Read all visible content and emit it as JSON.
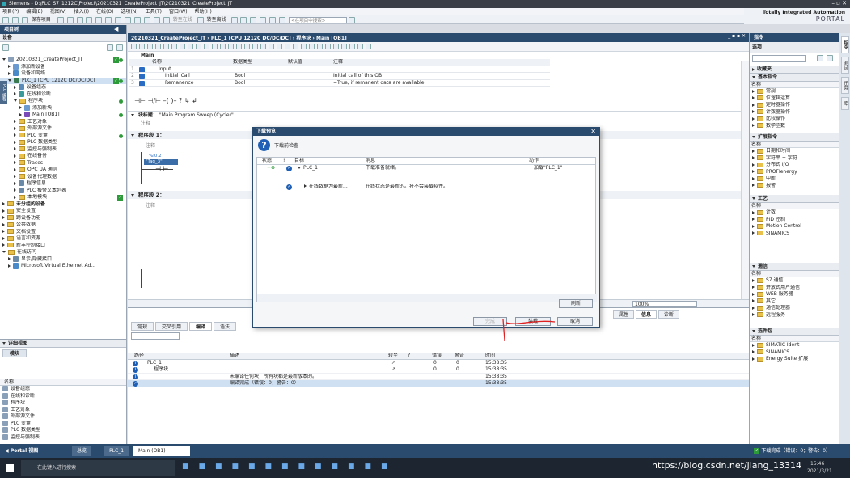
{
  "title": "Siemens - D:\\PLC_S7_1212C\\Project\\20210321_CreateProject_JT\\20210321_CreateProject_JT",
  "menu": [
    "项目(P)",
    "编辑(E)",
    "视图(V)",
    "插入(I)",
    "在线(O)",
    "选项(N)",
    "工具(T)",
    "窗口(W)",
    "帮助(H)"
  ],
  "toolbar": {
    "save_label": "保存项目",
    "go_online": "转至在线",
    "go_offline": "转至离线",
    "search_placeholder": "<在项目中搜索>"
  },
  "brand": {
    "line1": "Totally Integrated Automation",
    "line2": "PORTAL"
  },
  "project_tree": {
    "header": "项目树",
    "devices_tab": "设备",
    "items": [
      {
        "label": "20210321_CreateProject_JT",
        "indent": 0,
        "open": true,
        "status": "both",
        "icon": "project"
      },
      {
        "label": "添加新设备",
        "indent": 1,
        "icon": "add"
      },
      {
        "label": "设备和网络",
        "indent": 1,
        "icon": "net"
      },
      {
        "label": "PLC_1 [CPU 1212C DC/DC/DC]",
        "indent": 1,
        "open": true,
        "status": "both",
        "icon": "plc",
        "selected": true
      },
      {
        "label": "设备组态",
        "indent": 2,
        "icon": "cfg"
      },
      {
        "label": "在线和诊断",
        "indent": 2,
        "icon": "diag"
      },
      {
        "label": "程序块",
        "indent": 2,
        "open": true,
        "status": "dot",
        "icon": "folder"
      },
      {
        "label": "添加新块",
        "indent": 3,
        "icon": "add"
      },
      {
        "label": "Main [OB1]",
        "indent": 3,
        "status": "dot",
        "icon": "ob"
      },
      {
        "label": "工艺对象",
        "indent": 2,
        "icon": "folder"
      },
      {
        "label": "外部源文件",
        "indent": 2,
        "icon": "folder"
      },
      {
        "label": "PLC 变量",
        "indent": 2,
        "status": "dot",
        "icon": "folder"
      },
      {
        "label": "PLC 数据类型",
        "indent": 2,
        "icon": "folder"
      },
      {
        "label": "监控与强制表",
        "indent": 2,
        "icon": "folder"
      },
      {
        "label": "在线备份",
        "indent": 2,
        "icon": "folder"
      },
      {
        "label": "Traces",
        "indent": 2,
        "icon": "folder"
      },
      {
        "label": "OPC UA 通信",
        "indent": 2,
        "icon": "folder"
      },
      {
        "label": "设备代理数据",
        "indent": 2,
        "icon": "folder"
      },
      {
        "label": "程序信息",
        "indent": 2,
        "icon": "info"
      },
      {
        "label": "PLC 报警文本列表",
        "indent": 2,
        "icon": "info"
      },
      {
        "label": "本地模块",
        "indent": 2,
        "status": "chk",
        "icon": "folder"
      },
      {
        "label": "未分组的设备",
        "indent": 0,
        "icon": "folder",
        "bold": true
      },
      {
        "label": "安全设置",
        "indent": 0,
        "icon": "folder"
      },
      {
        "label": "跨设备功能",
        "indent": 0,
        "icon": "folder"
      },
      {
        "label": "公共数据",
        "indent": 0,
        "icon": "folder"
      },
      {
        "label": "文档设置",
        "indent": 0,
        "icon": "folder"
      },
      {
        "label": "语言和资源",
        "indent": 0,
        "icon": "folder"
      },
      {
        "label": "新丰控制接口",
        "indent": 0,
        "icon": "folder"
      },
      {
        "label": "在线访问",
        "indent": 0,
        "open": true,
        "icon": "folder"
      },
      {
        "label": "显示/隐藏接口",
        "indent": 1,
        "icon": "info"
      },
      {
        "label": "Microsoft Virtual Ethernet Ad...",
        "indent": 1,
        "icon": "net"
      }
    ]
  },
  "details": {
    "header": "详细视图",
    "tab": "模块",
    "col": "名称",
    "items": [
      "设备组态",
      "在线和诊断",
      "程序块",
      "工艺对象",
      "外部源文件",
      "PLC 变量",
      "PLC 数据类型",
      "监控与强制表"
    ]
  },
  "editor": {
    "title": "20210321_CreateProject_JT › PLC_1 [CPU 1212C DC/DC/DC] › 程序块 › Main [OB1]",
    "block": "Main",
    "iface_headers": [
      "名称",
      "数据类型",
      "默认值",
      "注释"
    ],
    "iface_rows": [
      {
        "n": "1",
        "name": "Input",
        "type": "",
        "def": "",
        "cmt": ""
      },
      {
        "n": "2",
        "name": "Initial_Call",
        "type": "Bool",
        "def": "",
        "cmt": "Initial call of this OB"
      },
      {
        "n": "3",
        "name": "Remanence",
        "type": "Bool",
        "def": "",
        "cmt": "=True, if remanent data are available"
      }
    ],
    "block_title_label": "块标题：",
    "block_title": "\"Main Program Sweep (Cycle)\"",
    "comment": "注释",
    "net1": "程序段 1：",
    "net2": "程序段 2：",
    "contact_addr": "%I0.2",
    "contact_tag": "\"Tag_3\"",
    "zoom": "100%"
  },
  "dialog": {
    "title": "下载预览",
    "subtitle": "下载前检查",
    "headers": [
      "状态",
      "!",
      "目标",
      "消息",
      "动作"
    ],
    "rows": [
      {
        "target": "PLC_1",
        "msg": "下载准备就绪。",
        "action": "加载\"PLC_1\""
      },
      {
        "target": "在线数据为最新...",
        "msg": "在线状态是最新的。将不会装载软件。",
        "action": ""
      }
    ],
    "refresh": "刷新",
    "finish": "完成",
    "load": "装载",
    "cancel": "取消"
  },
  "inspector": {
    "tabs": [
      "常规",
      "交叉引用",
      "编译",
      "语法"
    ],
    "active_tab": "编译",
    "right_tabs": [
      "属性",
      "信息",
      "诊断"
    ],
    "headers": [
      "路径",
      "描述",
      "转至",
      "?",
      "错误",
      "警告",
      "时间"
    ],
    "rows": [
      {
        "path": "PLC_1",
        "desc": "",
        "err": "0",
        "warn": "0",
        "time": "15:38:35"
      },
      {
        "path": "程序块",
        "desc": "",
        "err": "0",
        "warn": "0",
        "time": "15:38:35"
      },
      {
        "path": "",
        "desc": "未编译任何块，所有块都是最新版本的。",
        "err": "",
        "warn": "",
        "time": "15:38:35"
      },
      {
        "path": "",
        "desc": "编译完成（错误：0；警告：0）",
        "err": "",
        "warn": "",
        "time": "15:38:35"
      }
    ]
  },
  "task": {
    "header": "指令",
    "options": "选项",
    "favorites": "收藏夹",
    "basic": "基本指令",
    "name_col": "名称",
    "basic_items": [
      "常规",
      "位逻辑运算",
      "定时器操作",
      "计数器操作",
      "比较操作",
      "数学函数"
    ],
    "extended": "扩展指令",
    "extended_items": [
      "日期和时间",
      "字符串 + 字符",
      "分布式 I/O",
      "PROFIenergy",
      "中断",
      "报警"
    ],
    "tech": "工艺",
    "tech_items": [
      "计数",
      "PID 控制",
      "Motion Control",
      "SINAMICS"
    ],
    "comm": "通信",
    "comm_items": [
      "S7 通信",
      "开放式用户通信",
      "WEB 服务器",
      "其它",
      "通信处理器",
      "远程服务"
    ],
    "optpkg": "选件包",
    "opt_items": [
      "SIMATIC Ident",
      "SINAMICS",
      "Energy Suite 扩展"
    ],
    "side": [
      "指令",
      "测试",
      "任务",
      "库"
    ]
  },
  "portal": {
    "portal_view": "Portal 视图",
    "overview": "总览",
    "plc_tab": "PLC_1",
    "main_tab": "Main (OB1)",
    "status": "下载完成（错误：0；警告：0）"
  },
  "taskbar": {
    "search": "在此键入进行搜索",
    "time": "15:46",
    "date": "2021/3/21"
  },
  "watermark": "https://blog.csdn.net/jiang_13314"
}
